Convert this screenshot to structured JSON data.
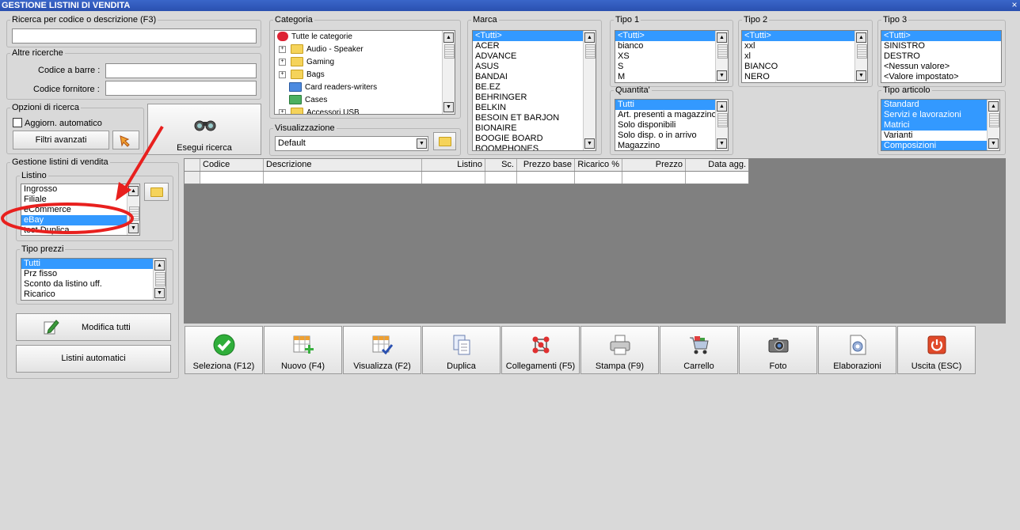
{
  "window": {
    "title": "GESTIONE LISTINI DI VENDITA",
    "close_glyph": "×"
  },
  "search": {
    "legend": "Ricerca per codice o descrizione (F3)",
    "value": ""
  },
  "altre": {
    "legend": "Altre ricerche",
    "barcode_label": "Codice a barre :",
    "supplier_label": "Codice fornitore :"
  },
  "opzioni": {
    "legend": "Opzioni di ricerca",
    "auto_update_label": "Aggiorn. automatico",
    "filters_button": "Filtri avanzati",
    "search_button": "Esegui ricerca"
  },
  "categoria": {
    "legend": "Categoria",
    "items": [
      "Tutte le categorie",
      "Audio - Speaker",
      "Gaming",
      "Bags",
      "Card readers-writers",
      "Cases",
      "Accessori USB"
    ]
  },
  "visualizzazione": {
    "legend": "Visualizzazione",
    "selected": "Default"
  },
  "marca": {
    "legend": "Marca",
    "items": [
      "<Tutti>",
      "ACER",
      "ADVANCE",
      "ASUS",
      "BANDAI",
      "BE.EZ",
      "BEHRINGER",
      "BELKIN",
      "BESOIN ET BARJON",
      "BIONAIRE",
      "BOOGIE BOARD",
      "BOOMPHONES"
    ]
  },
  "tipo1": {
    "legend": "Tipo 1",
    "items": [
      "<Tutti>",
      "bianco",
      "XS",
      "S",
      "M"
    ]
  },
  "tipo2": {
    "legend": "Tipo 2",
    "items": [
      "<Tutti>",
      "xxl",
      "xl",
      "BIANCO",
      "NERO"
    ]
  },
  "tipo3": {
    "legend": "Tipo 3",
    "items": [
      "<Tutti>",
      "SINISTRO",
      "DESTRO",
      "<Nessun valore>",
      "<Valore impostato>"
    ]
  },
  "quantita": {
    "legend": "Quantita'",
    "items": [
      "Tutti",
      "Art. presenti a magazzino",
      "Solo disponibili",
      "Solo disp. o in arrivo",
      "Magazzino"
    ]
  },
  "tipo_articolo": {
    "legend": "Tipo articolo",
    "items": [
      "Standard",
      "Servizi e lavorazioni",
      "Matrici",
      "Varianti",
      "Composizioni"
    ]
  },
  "gestione": {
    "legend": "Gestione listini di vendita"
  },
  "listino": {
    "legend": "Listino",
    "items": [
      "Ingrosso",
      "Filiale",
      "eCommerce",
      "eBay",
      "test Duplica"
    ]
  },
  "tipo_prezzi": {
    "legend": "Tipo prezzi",
    "items": [
      "Tutti",
      "Prz fisso",
      "Sconto da listino uff.",
      "Ricarico"
    ]
  },
  "side_buttons": {
    "modifica": "Modifica tutti",
    "automatici": "Listini automatici"
  },
  "grid": {
    "columns": [
      "Codice",
      "Descrizione",
      "Listino",
      "Sc.",
      "Prezzo base",
      "Ricarico %",
      "Prezzo",
      "Data agg."
    ]
  },
  "toolbar": [
    {
      "label": "Seleziona (F12)",
      "icon": "check-icon"
    },
    {
      "label": "Nuovo (F4)",
      "icon": "new-grid-icon"
    },
    {
      "label": "Visualizza (F2)",
      "icon": "view-grid-icon"
    },
    {
      "label": "Duplica",
      "icon": "duplicate-icon"
    },
    {
      "label": "Collegamenti (F5)",
      "icon": "links-icon"
    },
    {
      "label": "Stampa (F9)",
      "icon": "printer-icon"
    },
    {
      "label": "Carrello",
      "icon": "cart-icon"
    },
    {
      "label": "Foto",
      "icon": "camera-icon"
    },
    {
      "label": "Elaborazioni",
      "icon": "gear-doc-icon"
    },
    {
      "label": "Uscita (ESC)",
      "icon": "power-icon"
    }
  ],
  "colors": {
    "selection": "#3399ff",
    "grid_background": "#808080",
    "annotation": "#e8201e"
  }
}
